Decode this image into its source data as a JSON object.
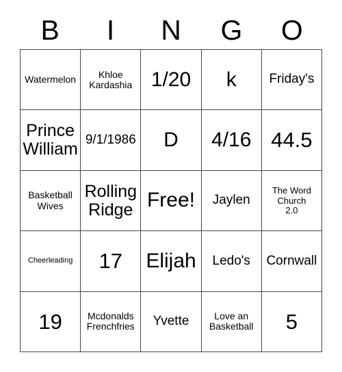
{
  "card": {
    "header_letters": [
      "B",
      "I",
      "N",
      "G",
      "O"
    ],
    "rows": [
      [
        {
          "text": "Watermelon",
          "size": "sm"
        },
        {
          "text": "Khloe\nKardashia",
          "size": "sm"
        },
        {
          "text": "1/20",
          "size": "xl"
        },
        {
          "text": "k",
          "size": "xl"
        },
        {
          "text": "Friday's",
          "size": "md"
        }
      ],
      [
        {
          "text": "Prince\nWilliam",
          "size": "lg"
        },
        {
          "text": "9/1/1986",
          "size": "md"
        },
        {
          "text": "D",
          "size": "xl"
        },
        {
          "text": "4/16",
          "size": "xl"
        },
        {
          "text": "44.5",
          "size": "xxl"
        }
      ],
      [
        {
          "text": "Basketball\nWives",
          "size": "sm"
        },
        {
          "text": "Rolling\nRidge",
          "size": "lg"
        },
        {
          "text": "Free!",
          "size": "xl"
        },
        {
          "text": "Jaylen",
          "size": "md"
        },
        {
          "text": "The Word\nChurch\n2.0",
          "size": "xs"
        }
      ],
      [
        {
          "text": "Cheerleading",
          "size": "xxs"
        },
        {
          "text": "17",
          "size": "xxl"
        },
        {
          "text": "Elijah",
          "size": "xl"
        },
        {
          "text": "Ledo's",
          "size": "md"
        },
        {
          "text": "Cornwall",
          "size": "md"
        }
      ],
      [
        {
          "text": "19",
          "size": "xxl"
        },
        {
          "text": "Mcdonalds\nFrenchfries",
          "size": "sm"
        },
        {
          "text": "Yvette",
          "size": "md"
        },
        {
          "text": "Love an\nBasketball",
          "size": "sm"
        },
        {
          "text": "5",
          "size": "xxl"
        }
      ]
    ]
  },
  "colors": {
    "background": "#ffffff",
    "text": "#000000",
    "grid_line": "#444444"
  }
}
